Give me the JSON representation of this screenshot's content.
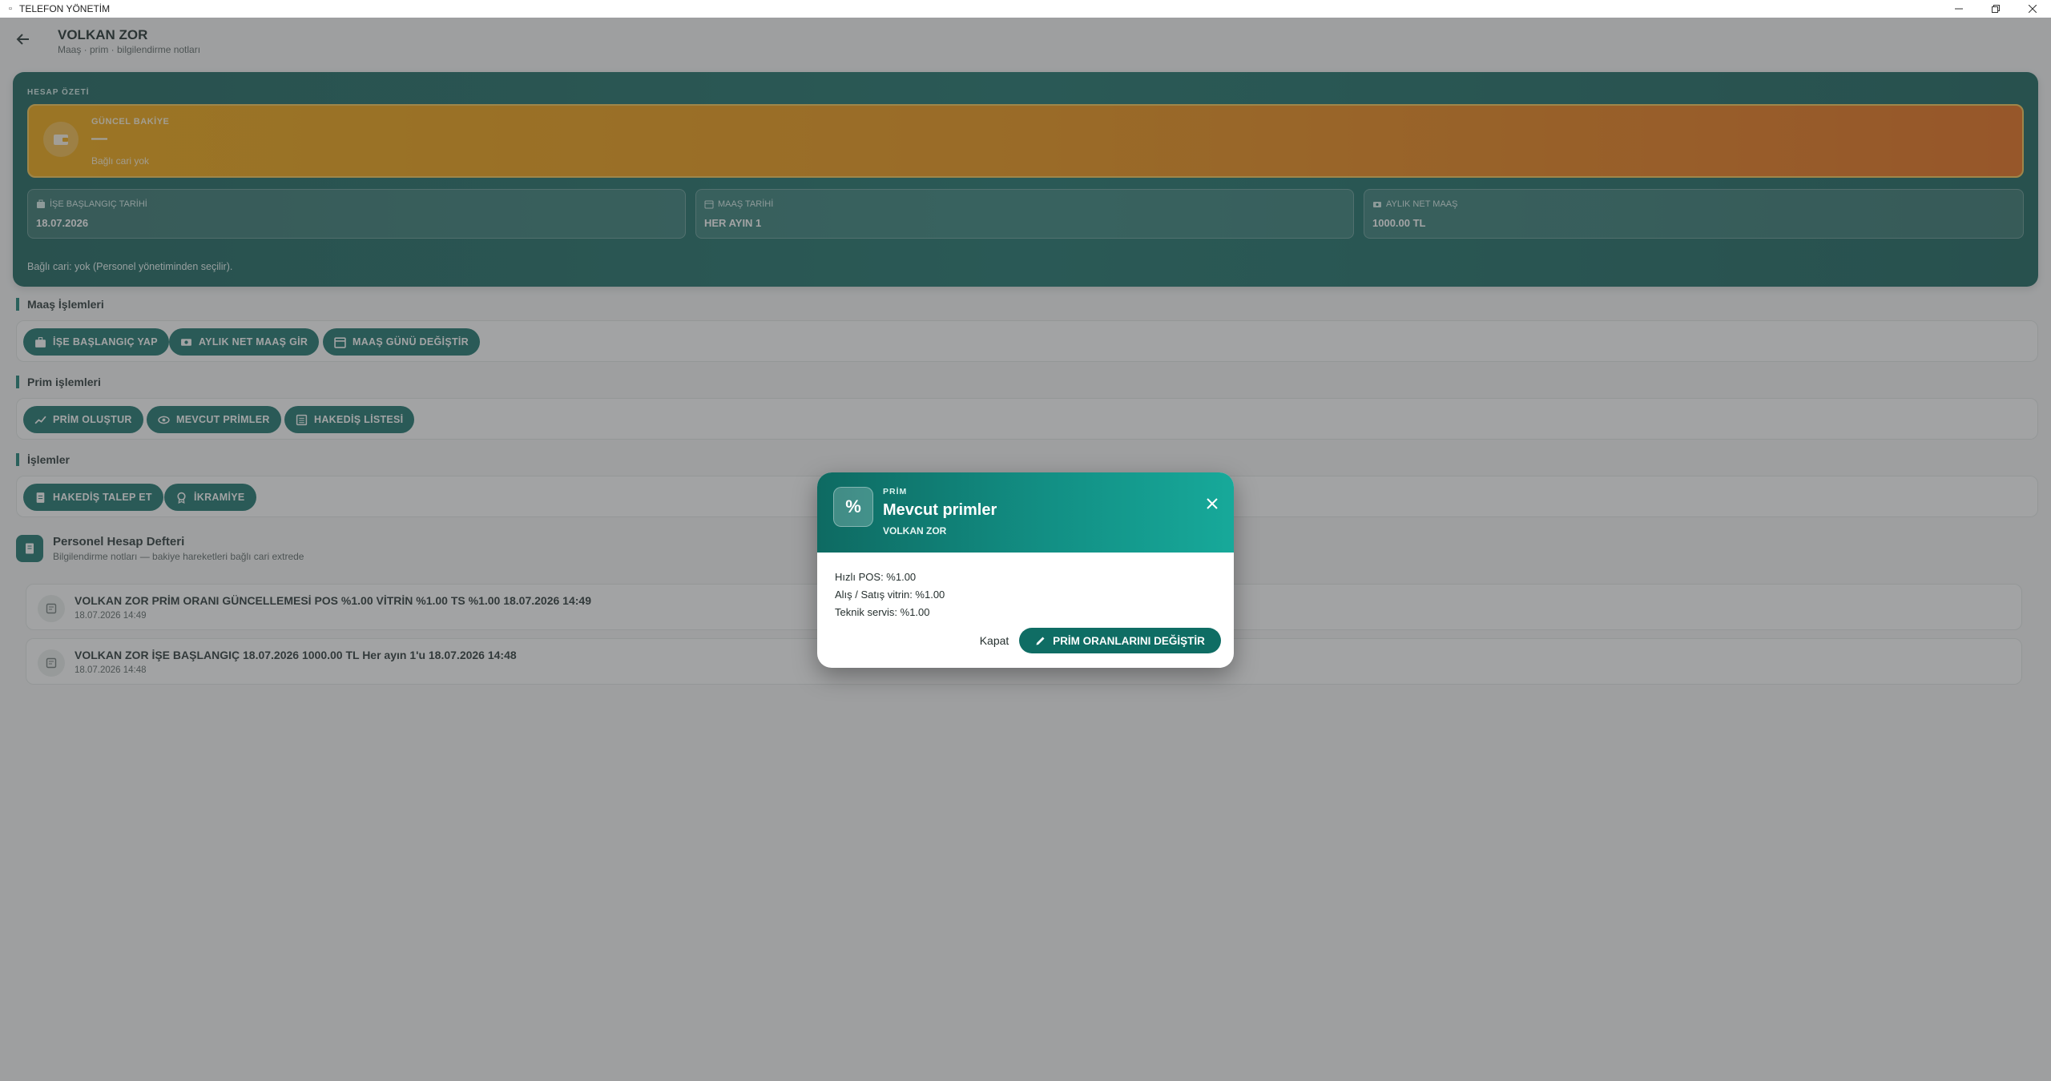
{
  "window": {
    "title": "TELEFON YÖNETİM"
  },
  "header": {
    "name": "VOLKAN ZOR",
    "subtitle": "Maaş · prim · bilgilendirme notları"
  },
  "summary": {
    "section_label": "HESAP ÖZETİ",
    "balance": {
      "label": "GÜNCEL BAKİYE",
      "value": "—",
      "note": "Bağlı cari yok"
    },
    "info": [
      {
        "label": "İŞE BAŞLANGIÇ TARİHİ",
        "value": "18.07.2026",
        "icon": "briefcase-icon"
      },
      {
        "label": "MAAŞ TARİHİ",
        "value": "HER AYIN 1",
        "icon": "calendar-icon"
      },
      {
        "label": "AYLIK NET MAAŞ",
        "value": "1000.00 TL",
        "icon": "money-icon"
      }
    ],
    "linked_note": "Bağlı cari: yok (Personel yönetiminden seçilir)."
  },
  "sections": {
    "salary": {
      "title": "Maaş İşlemleri",
      "buttons": [
        "İŞE BAŞLANGIÇ YAP",
        "AYLIK NET MAAŞ GİR",
        "MAAŞ GÜNÜ DEĞİŞTİR"
      ]
    },
    "bonus": {
      "title": "Prim işlemleri",
      "buttons": [
        "PRİM OLUŞTUR",
        "MEVCUT PRİMLER",
        "HAKEDİŞ LİSTESİ"
      ]
    },
    "ops": {
      "title": "İşlemler",
      "buttons": [
        "HAKEDİŞ TALEP ET",
        "İKRAMİYE"
      ]
    }
  },
  "ledger": {
    "title": "Personel Hesap Defteri",
    "subtitle": "Bilgilendirme notları — bakiye hareketleri bağlı cari extrede",
    "rows": [
      {
        "text": "VOLKAN ZOR PRİM ORANI GÜNCELLEMESİ POS %1.00 VİTRİN %1.00 TS %1.00 18.07.2026 14:49",
        "date": "18.07.2026 14:49"
      },
      {
        "text": "VOLKAN ZOR İŞE BAŞLANGIÇ 18.07.2026 1000.00 TL Her ayın 1'u 18.07.2026 14:48",
        "date": "18.07.2026 14:48"
      }
    ]
  },
  "modal": {
    "icon_text": "%",
    "kicker": "PRİM",
    "title": "Mevcut primler",
    "person": "VOLKAN ZOR",
    "lines": [
      "Hızlı POS: %1.00",
      "Alış / Satış vitrin: %1.00",
      "Teknik servis: %1.00"
    ],
    "cancel_label": "Kapat",
    "primary_label": "PRİM ORANLARINI DEĞİŞTİR"
  },
  "colors": {
    "accent": "#0f6d64",
    "balance_start": "#f0a300",
    "balance_end": "#e8660b",
    "overlay": "#46484a"
  }
}
